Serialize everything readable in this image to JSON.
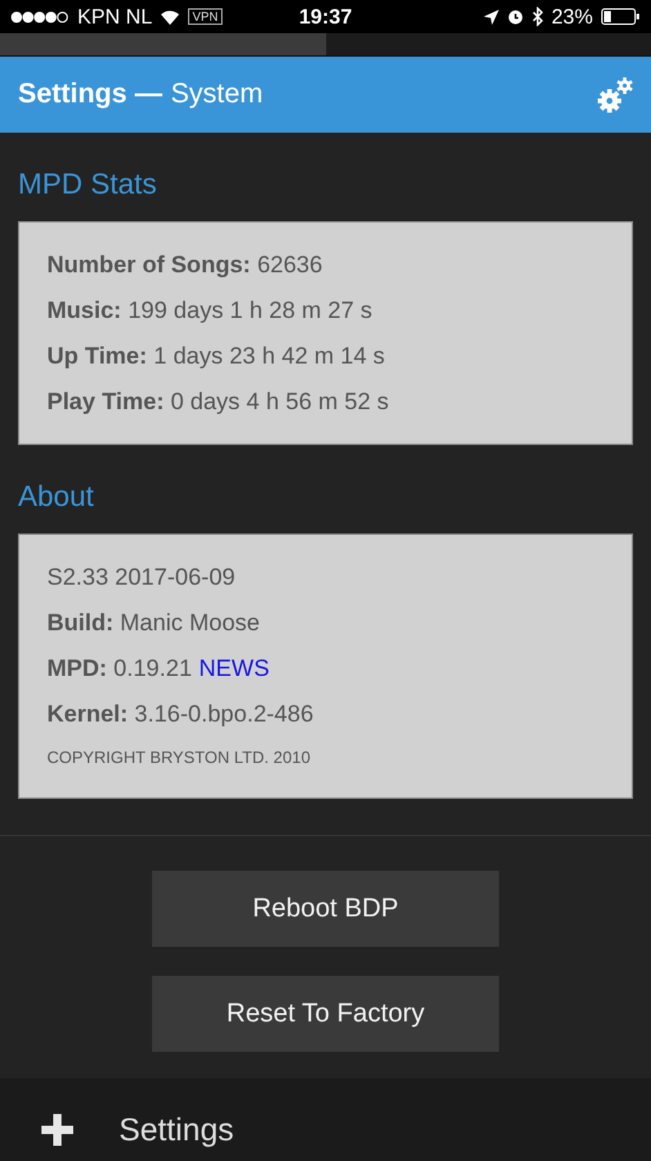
{
  "status_bar": {
    "carrier": "KPN NL",
    "vpn": "VPN",
    "time": "19:37",
    "battery": "23%"
  },
  "loading": {
    "level": 0.5
  },
  "header": {
    "title": "Settings —",
    "subtitle": "System"
  },
  "sections": [
    {
      "title": "MPD Stats",
      "rows": [
        {
          "kind": "line",
          "text": "**Number of Songs:** 62636"
        },
        {
          "kind": "line",
          "text": "**Music:** 199 days 1 h 28 m 27 s"
        },
        {
          "kind": "line",
          "text": "**Up Time:** 1 days 23 h 42 m 14 s"
        },
        {
          "kind": "line",
          "text": "**Play Time:** 0 days 4 h 56 m 52 s"
        }
      ]
    },
    {
      "title": "About",
      "rows": [
        {
          "kind": "line",
          "text": "S2.33 2017-06-09"
        },
        {
          "kind": "line",
          "text": "**Build:** Manic Moose"
        },
        {
          "kind": "line",
          "text": "**MPD:** 0.19.21",
          "link": "NEWS"
        },
        {
          "kind": "line",
          "text": "**Kernel:** 3.16-0.bpo.2-486"
        },
        {
          "kind": "note",
          "text": "COPYRIGHT BRYSTON LTD. 2010"
        }
      ]
    }
  ],
  "buttons": [
    "Reboot BDP",
    "Reset To Factory"
  ],
  "footer": {
    "label": "Settings"
  }
}
